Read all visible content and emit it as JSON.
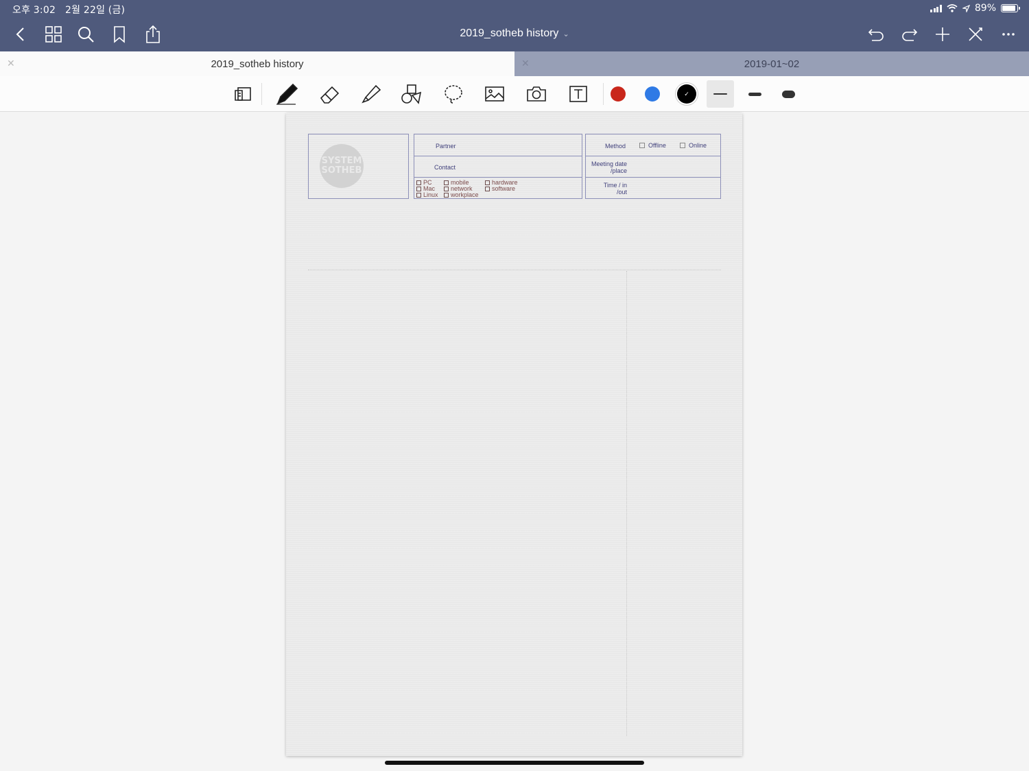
{
  "status": {
    "time": "오후 3:02",
    "date": "2월 22일 (금)",
    "battery": "89%",
    "battery_level": 0.89
  },
  "nav": {
    "title": "2019_sotheb history",
    "left_icons": [
      "back-icon",
      "grid-icon",
      "search-icon",
      "bookmark-icon",
      "share-icon"
    ],
    "right_icons": [
      "undo-icon",
      "redo-icon",
      "add-icon",
      "close-icon",
      "more-icon"
    ]
  },
  "tabs": [
    {
      "label": "2019_sotheb history",
      "active": true
    },
    {
      "label": "2019-01~02",
      "active": false
    }
  ],
  "toolbar": {
    "tools": [
      "reader-mode-icon",
      "pen-icon",
      "eraser-icon",
      "highlighter-icon",
      "shapes-icon",
      "lasso-icon",
      "image-icon",
      "camera-icon",
      "text-icon"
    ],
    "colors": [
      "#c9271b",
      "#2f7ae5",
      "#000000"
    ],
    "selected_color": "#000000",
    "stroke_widths": [
      "thin",
      "medium",
      "thick"
    ],
    "selected_stroke": "thin"
  },
  "form": {
    "logo_line1": "SYSTEM",
    "logo_line2": "SOTHEB",
    "partner": "Partner",
    "contact": "Contact",
    "categories": [
      "PC",
      "Mac",
      "Linux",
      "mobile",
      "network",
      "workplace",
      "hardware",
      "software"
    ],
    "method": "Method",
    "offline": "Offline",
    "online": "Online",
    "meeting_date": "Meeting date",
    "place": "/place",
    "time_in": "Time / in",
    "time_out": "/out"
  }
}
